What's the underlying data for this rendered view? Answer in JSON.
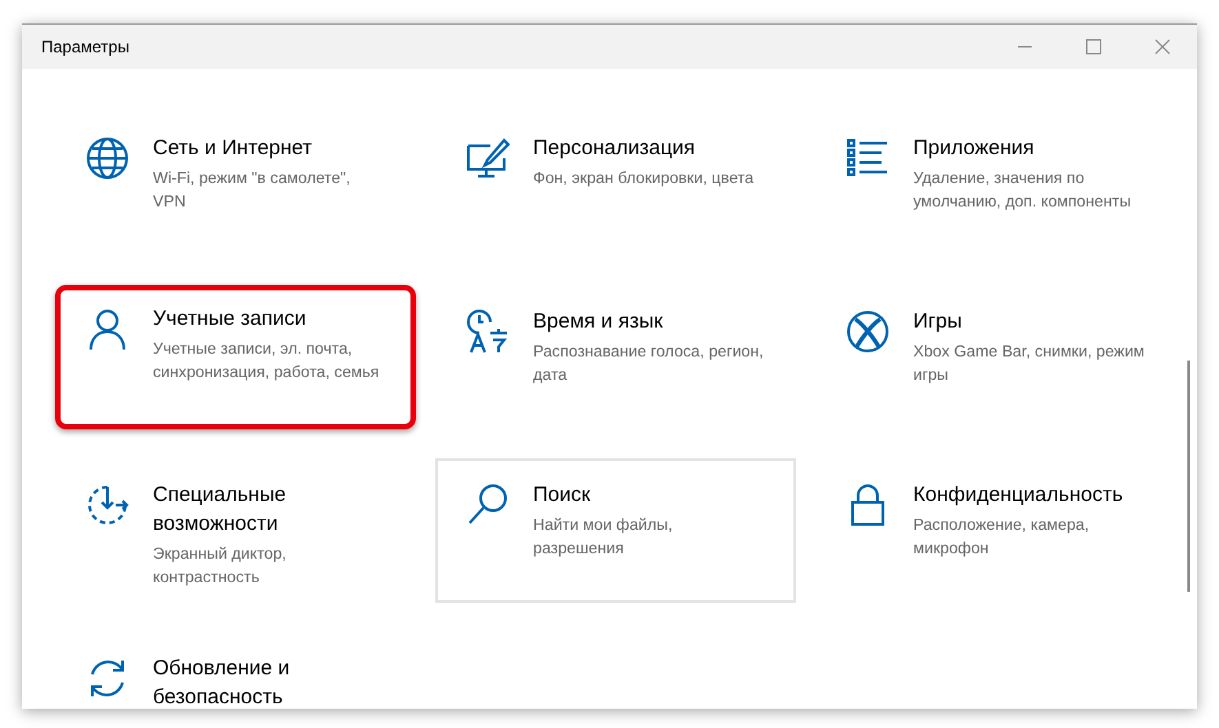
{
  "window": {
    "title": "Параметры"
  },
  "tiles": [
    {
      "title": "Сеть и Интернет",
      "description": "Wi-Fi, режим \"в самолете\", VPN",
      "highlighted": false,
      "hovered": false
    },
    {
      "title": "Персонализация",
      "description": "Фон, экран блокировки, цвета",
      "highlighted": false,
      "hovered": false
    },
    {
      "title": "Приложения",
      "description": "Удаление, значения по умолчанию, доп. компоненты",
      "highlighted": false,
      "hovered": false
    },
    {
      "title": "Учетные записи",
      "description": "Учетные записи, эл. почта, синхронизация, работа, семья",
      "highlighted": true,
      "hovered": false
    },
    {
      "title": "Время и язык",
      "description": "Распознавание голоса, регион, дата",
      "highlighted": false,
      "hovered": false
    },
    {
      "title": "Игры",
      "description": "Xbox Game Bar, снимки, режим игры",
      "highlighted": false,
      "hovered": false
    },
    {
      "title": "Специальные возможности",
      "description": "Экранный диктор, контрастность",
      "highlighted": false,
      "hovered": false
    },
    {
      "title": "Поиск",
      "description": "Найти мои файлы, разрешения",
      "highlighted": false,
      "hovered": true
    },
    {
      "title": "Конфиденциальность",
      "description": "Расположение, камера, микрофон",
      "highlighted": false,
      "hovered": false
    },
    {
      "title": "Обновление и безопасность",
      "highlighted": false,
      "hovered": false
    }
  ]
}
